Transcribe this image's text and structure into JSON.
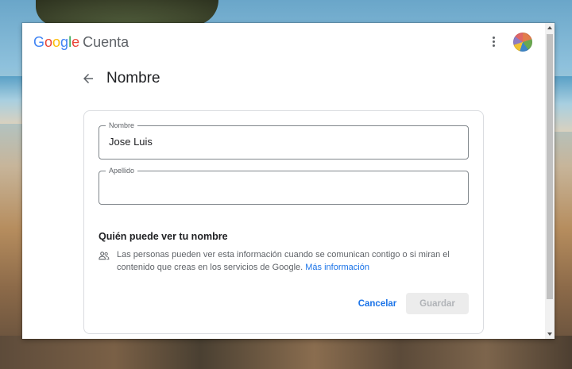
{
  "header": {
    "brand_letters": [
      "G",
      "o",
      "o",
      "g",
      "l",
      "e"
    ],
    "product": "Cuenta"
  },
  "page": {
    "title": "Nombre"
  },
  "form": {
    "first_name": {
      "label": "Nombre",
      "value": "Jose Luis"
    },
    "last_name": {
      "label": "Apellido",
      "value": ""
    }
  },
  "visibility": {
    "title": "Quién puede ver tu nombre",
    "text": "Las personas pueden ver esta información cuando se comunican contigo o si miran el contenido que creas en los servicios de Google.",
    "link": "Más información"
  },
  "actions": {
    "cancel": "Cancelar",
    "save": "Guardar"
  },
  "icons": {
    "back": "arrow-left-icon",
    "more": "more-vertical-icon",
    "people": "people-icon"
  },
  "colors": {
    "accent": "#1a73e8",
    "text": "#202124",
    "secondary": "#5f6368"
  }
}
